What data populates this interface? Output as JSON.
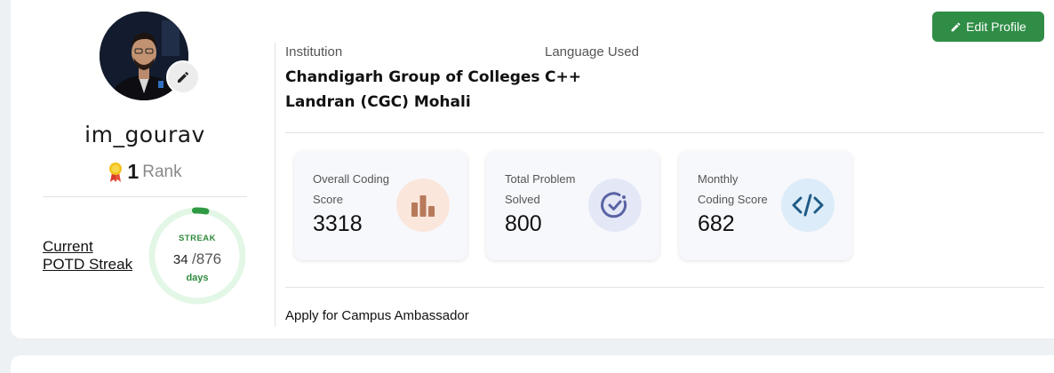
{
  "profile": {
    "username": "im_gourav",
    "rank_number": "1",
    "rank_label": "Rank"
  },
  "potd": {
    "link_line1": "Current",
    "link_line2": "POTD Streak",
    "streak_label": "STREAK",
    "current": "34",
    "total": "/876",
    "days_label": "days",
    "streak_fraction": 0.039
  },
  "info": {
    "institution_label": "Institution",
    "institution_line1": "Chandigarh Group of Colleges",
    "institution_line2": "Landran (CGC) Mohali",
    "language_label": "Language Used",
    "language_value": "C++"
  },
  "edit_profile_label": "Edit Profile",
  "stats": [
    {
      "title_line1": "Overall Coding",
      "title_line2": "Score",
      "value": "3318",
      "icon": "bar-chart-icon"
    },
    {
      "title_line1": "Total Problem",
      "title_line2": "Solved",
      "value": "800",
      "icon": "check-circle-icon"
    },
    {
      "title_line1": "Monthly",
      "title_line2": "Coding Score",
      "value": "682",
      "icon": "code-icon"
    }
  ],
  "campus_link": "Apply for Campus Ambassador",
  "colors": {
    "accent_green": "#2f8d46",
    "streak_ring": "#e3f7e6",
    "streak_progress": "#2f9a44",
    "bar_icon_bg": "#fbe6dc",
    "bar_icon_fg": "#b77a5a",
    "check_icon_bg": "#e4e8f6",
    "check_icon_fg": "#5a63a4",
    "code_icon_bg": "#dcecf8",
    "code_icon_fg": "#1f5a86"
  }
}
